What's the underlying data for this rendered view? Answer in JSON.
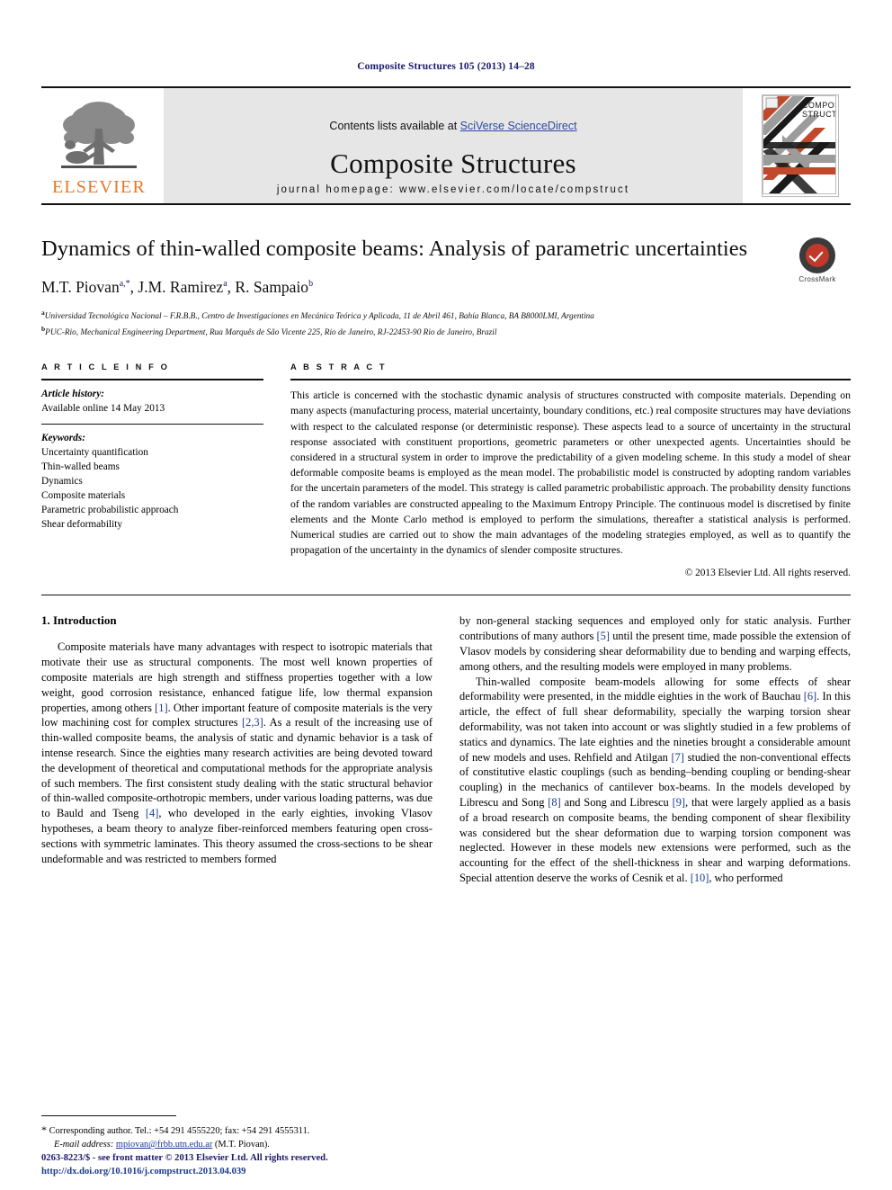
{
  "running_head": "Composite Structures 105 (2013) 14–28",
  "masthead": {
    "publisher_name": "ELSEVIER",
    "contents_prefix": "Contents lists available at ",
    "contents_link": "SciVerse ScienceDirect",
    "journal_title": "Composite Structures",
    "homepage": "journal homepage: www.elsevier.com/locate/compstruct",
    "cover_title_line1": "COMPOSITE",
    "cover_title_line2": "STRUCTURES"
  },
  "article": {
    "title": "Dynamics of thin-walled composite beams: Analysis of parametric uncertainties",
    "crossmark_label": "CrossMark",
    "authors": [
      {
        "name": "M.T. Piovan",
        "sup": "a,*"
      },
      {
        "name": "J.M. Ramirez",
        "sup": "a"
      },
      {
        "name": "R. Sampaio",
        "sup": "b"
      }
    ],
    "affiliations": [
      {
        "marker": "a",
        "text": "Universidad Tecnológica Nacional – F.R.B.B., Centro de Investigaciones en Mecánica Teórica y Aplicada, 11 de Abril 461, Bahía Blanca, BA B8000LMI, Argentina"
      },
      {
        "marker": "b",
        "text": "PUC-Rio, Mechanical Engineering Department, Rua Marquês de São Vicente 225, Rio de Janeiro, RJ-22453-90 Rio de Janeiro, Brazil"
      }
    ]
  },
  "article_info": {
    "heading": "A R T I C L E   I N F O",
    "history_label": "Article history:",
    "history_value": "Available online 14 May 2013",
    "keywords_label": "Keywords:",
    "keywords": [
      "Uncertainty quantification",
      "Thin-walled beams",
      "Dynamics",
      "Composite materials",
      "Parametric probabilistic approach",
      "Shear deformability"
    ]
  },
  "abstract": {
    "heading": "A B S T R A C T",
    "text": "This article is concerned with the stochastic dynamic analysis of structures constructed with composite materials. Depending on many aspects (manufacturing process, material uncertainty, boundary conditions, etc.) real composite structures may have deviations with respect to the calculated response (or deterministic response). These aspects lead to a source of uncertainty in the structural response associated with constituent proportions, geometric parameters or other unexpected agents. Uncertainties should be considered in a structural system in order to improve the predictability of a given modeling scheme. In this study a model of shear deformable composite beams is employed as the mean model. The probabilistic model is constructed by adopting random variables for the uncertain parameters of the model. This strategy is called parametric probabilistic approach. The probability density functions of the random variables are constructed appealing to the Maximum Entropy Principle. The continuous model is discretised by finite elements and the Monte Carlo method is employed to perform the simulations, thereafter a statistical analysis is performed. Numerical studies are carried out to show the main advantages of the modeling strategies employed, as well as to quantify the propagation of the uncertainty in the dynamics of slender composite structures.",
    "copyright": "© 2013 Elsevier Ltd. All rights reserved."
  },
  "body": {
    "section_heading": "1. Introduction",
    "left_paragraphs": [
      "Composite materials have many advantages with respect to isotropic materials that motivate their use as structural components. The most well known properties of composite materials are high strength and stiffness properties together with a low weight, good corrosion resistance, enhanced fatigue life, low thermal expansion properties, among others [1]. Other important feature of composite materials is the very low machining cost for complex structures [2,3]. As a result of the increasing use of thin-walled composite beams, the analysis of static and dynamic behavior is a task of intense research. Since the eighties many research activities are being devoted toward the development of theoretical and computational methods for the appropriate analysis of such members. The first consistent study dealing with the static structural behavior of thin-walled composite-orthotropic members, under various loading patterns, was due to Bauld and Tseng [4], who developed in the early eighties, invoking Vlasov hypotheses, a beam theory to analyze fiber-reinforced members featuring open cross-sections with symmetric laminates. This theory assumed the cross-sections to be shear undeformable and was restricted to members formed"
    ],
    "right_paragraphs": [
      "by non-general stacking sequences and employed only for static analysis. Further contributions of many authors [5] until the present time, made possible the extension of Vlasov models by considering shear deformability due to bending and warping effects, among others, and the resulting models were employed in many problems.",
      "Thin-walled composite beam-models allowing for some effects of shear deformability were presented, in the middle eighties in the work of Bauchau [6]. In this article, the effect of full shear deformability, specially the warping torsion shear deformability, was not taken into account or was slightly studied in a few problems of statics and dynamics. The late eighties and the nineties brought a considerable amount of new models and uses. Rehfield and Atilgan [7] studied the non-conventional effects of constitutive elastic couplings (such as bending–bending coupling or bending-shear coupling) in the mechanics of cantilever box-beams. In the models developed by Librescu and Song [8] and Song and Librescu [9], that were largely applied as a basis of a broad research on composite beams, the bending component of shear flexibility was considered but the shear deformation due to warping torsion component was neglected. However in these models new extensions were performed, such as the accounting for the effect of the shell-thickness in shear and warping deformations. Special attention deserve the works of Cesnik et al. [10], who performed"
    ]
  },
  "footnote": {
    "star": "*",
    "corresponding": "Corresponding author. Tel.: +54 291 4555220; fax: +54 291 4555311.",
    "email_label": "E-mail address:",
    "email": "mpiovan@frbb.utn.edu.ar",
    "email_owner": "(M.T. Piovan)."
  },
  "footer": {
    "issn_line": "0263-8223/$ - see front matter © 2013 Elsevier Ltd. All rights reserved.",
    "doi_line": "http://dx.doi.org/10.1016/j.compstruct.2013.04.039"
  },
  "colors": {
    "elsevier_orange": "#E87722",
    "link_blue": "#2a4b9b",
    "ref_blue": "#1a3a8f",
    "header_navy": "#1a1a6e"
  }
}
